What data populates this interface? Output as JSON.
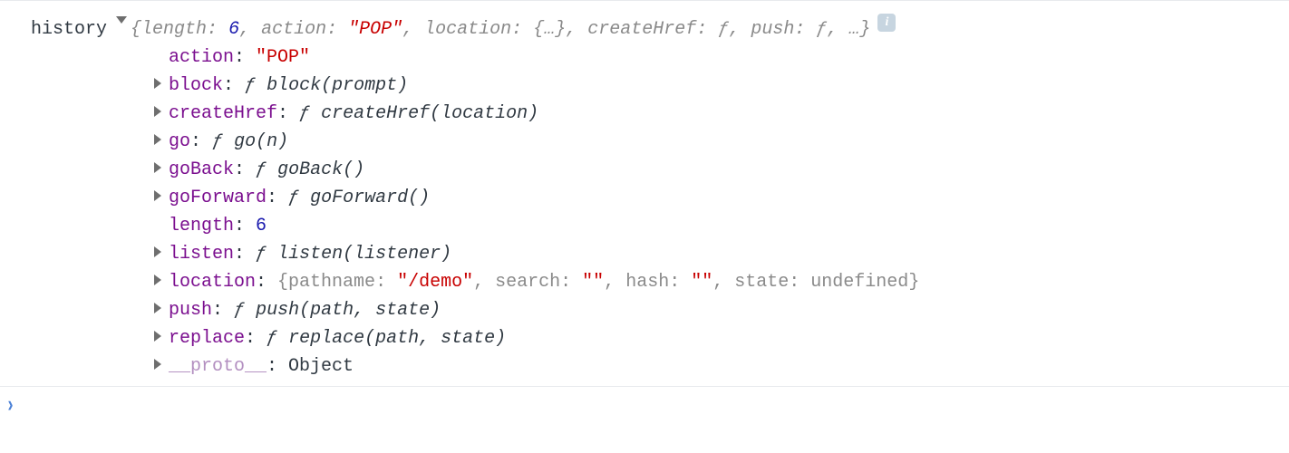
{
  "log": {
    "var_name": "history",
    "preview_parts": {
      "open": "{",
      "length_key": "length:",
      "length_val": "6",
      "action_key": "action:",
      "action_val": "\"POP\"",
      "location_key": "location:",
      "location_val": "{…}",
      "createHref_key": "createHref:",
      "createHref_val": "ƒ",
      "push_key": "push:",
      "push_val": "ƒ",
      "more": "…",
      "close": "}",
      "sep": ", "
    },
    "info_glyph": "i"
  },
  "entries": {
    "action": {
      "key": "action",
      "val": "\"POP\""
    },
    "block": {
      "key": "block",
      "sig": "block(prompt)"
    },
    "createHref": {
      "key": "createHref",
      "sig": "createHref(location)"
    },
    "go": {
      "key": "go",
      "sig": "go(n)"
    },
    "goBack": {
      "key": "goBack",
      "sig": "goBack()"
    },
    "goForward": {
      "key": "goForward",
      "sig": "goForward()"
    },
    "length": {
      "key": "length",
      "val": "6"
    },
    "listen": {
      "key": "listen",
      "sig": "listen(listener)"
    },
    "location": {
      "key": "location",
      "open": "{",
      "pathname_k": "pathname:",
      "pathname_v": "\"/demo\"",
      "search_k": "search:",
      "search_v": "\"\"",
      "hash_k": "hash:",
      "hash_v": "\"\"",
      "state_k": "state:",
      "state_v": "undefined",
      "close": "}",
      "sep": ", "
    },
    "push": {
      "key": "push",
      "sig": "push(path, state)"
    },
    "replace": {
      "key": "replace",
      "sig": "replace(path, state)"
    },
    "proto": {
      "key": "__proto__",
      "val": "Object"
    }
  },
  "fn_glyph": "ƒ",
  "colon": ": "
}
